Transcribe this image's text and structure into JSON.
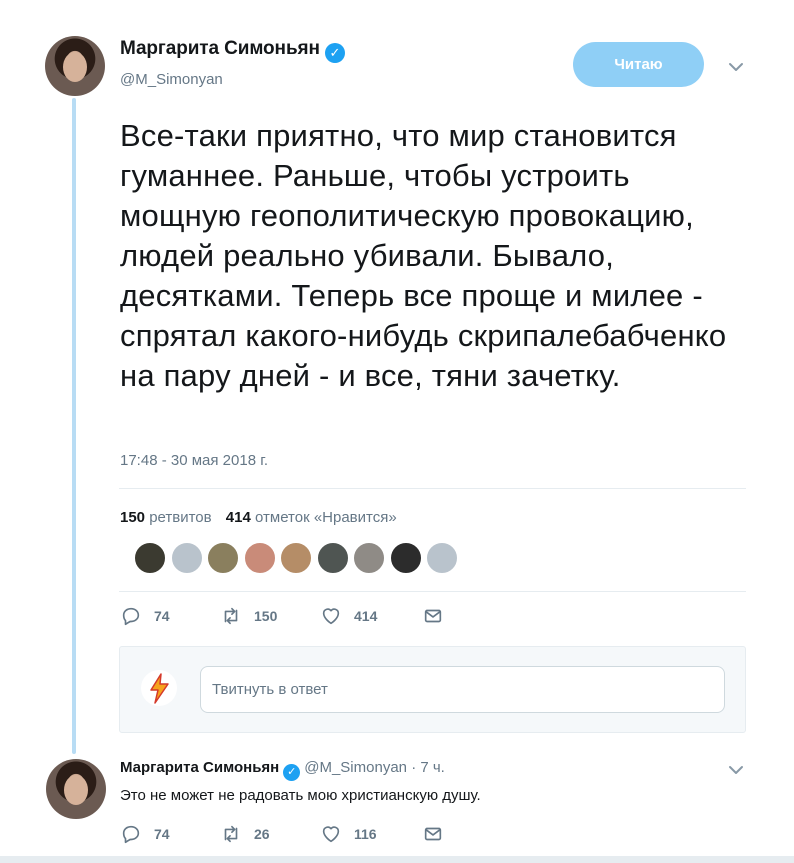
{
  "tweet": {
    "author_name": "Маргарита Симоньян",
    "author_handle": "@M_Simonyan",
    "follow_label": "Читаю",
    "text": "Все-таки приятно, что мир становится гуманнее. Раньше, чтобы устроить мощную геополитическую провокацию, людей реально убивали. Бывало, десятками. Теперь все проще и милее - спрятал какого-нибудь скрипалебабченко на пару дней - и все, тяни зачетку.",
    "timestamp": "17:48 - 30 мая 2018 г.",
    "retweets_count": "150",
    "retweets_label": "ретвитов",
    "likes_count": "414",
    "likes_label": "отметок «Нравится»",
    "likers": [
      {
        "name": "liker-avatar-1",
        "color": "#3b3a30"
      },
      {
        "name": "liker-avatar-2",
        "color": "#b9c3cc"
      },
      {
        "name": "liker-avatar-3",
        "color": "#8a7f5e"
      },
      {
        "name": "liker-avatar-4",
        "color": "#c98b79"
      },
      {
        "name": "liker-avatar-5",
        "color": "#b58d67"
      },
      {
        "name": "liker-avatar-6",
        "color": "#4f5552"
      },
      {
        "name": "liker-avatar-7",
        "color": "#8f8b86"
      },
      {
        "name": "liker-avatar-8",
        "color": "#2c2c2c"
      },
      {
        "name": "liker-avatar-9",
        "color": "#b9c3cc"
      }
    ],
    "actions": {
      "reply_count": "74",
      "retweet_count": "150",
      "like_count": "414"
    },
    "reply_placeholder": "Твитнуть в ответ"
  },
  "reply": {
    "author_name": "Маргарита Симоньян",
    "author_handle": "@M_Simonyan",
    "time": "· 7 ч.",
    "text": "Это не может не радовать мою христианскую душу.",
    "actions": {
      "reply_count": "74",
      "retweet_count": "26",
      "like_count": "116"
    }
  },
  "colors": {
    "accent": "#1da1f2",
    "follow_button": "#8fcff6",
    "thread_line": "#b8dcf4",
    "muted": "#657786"
  }
}
